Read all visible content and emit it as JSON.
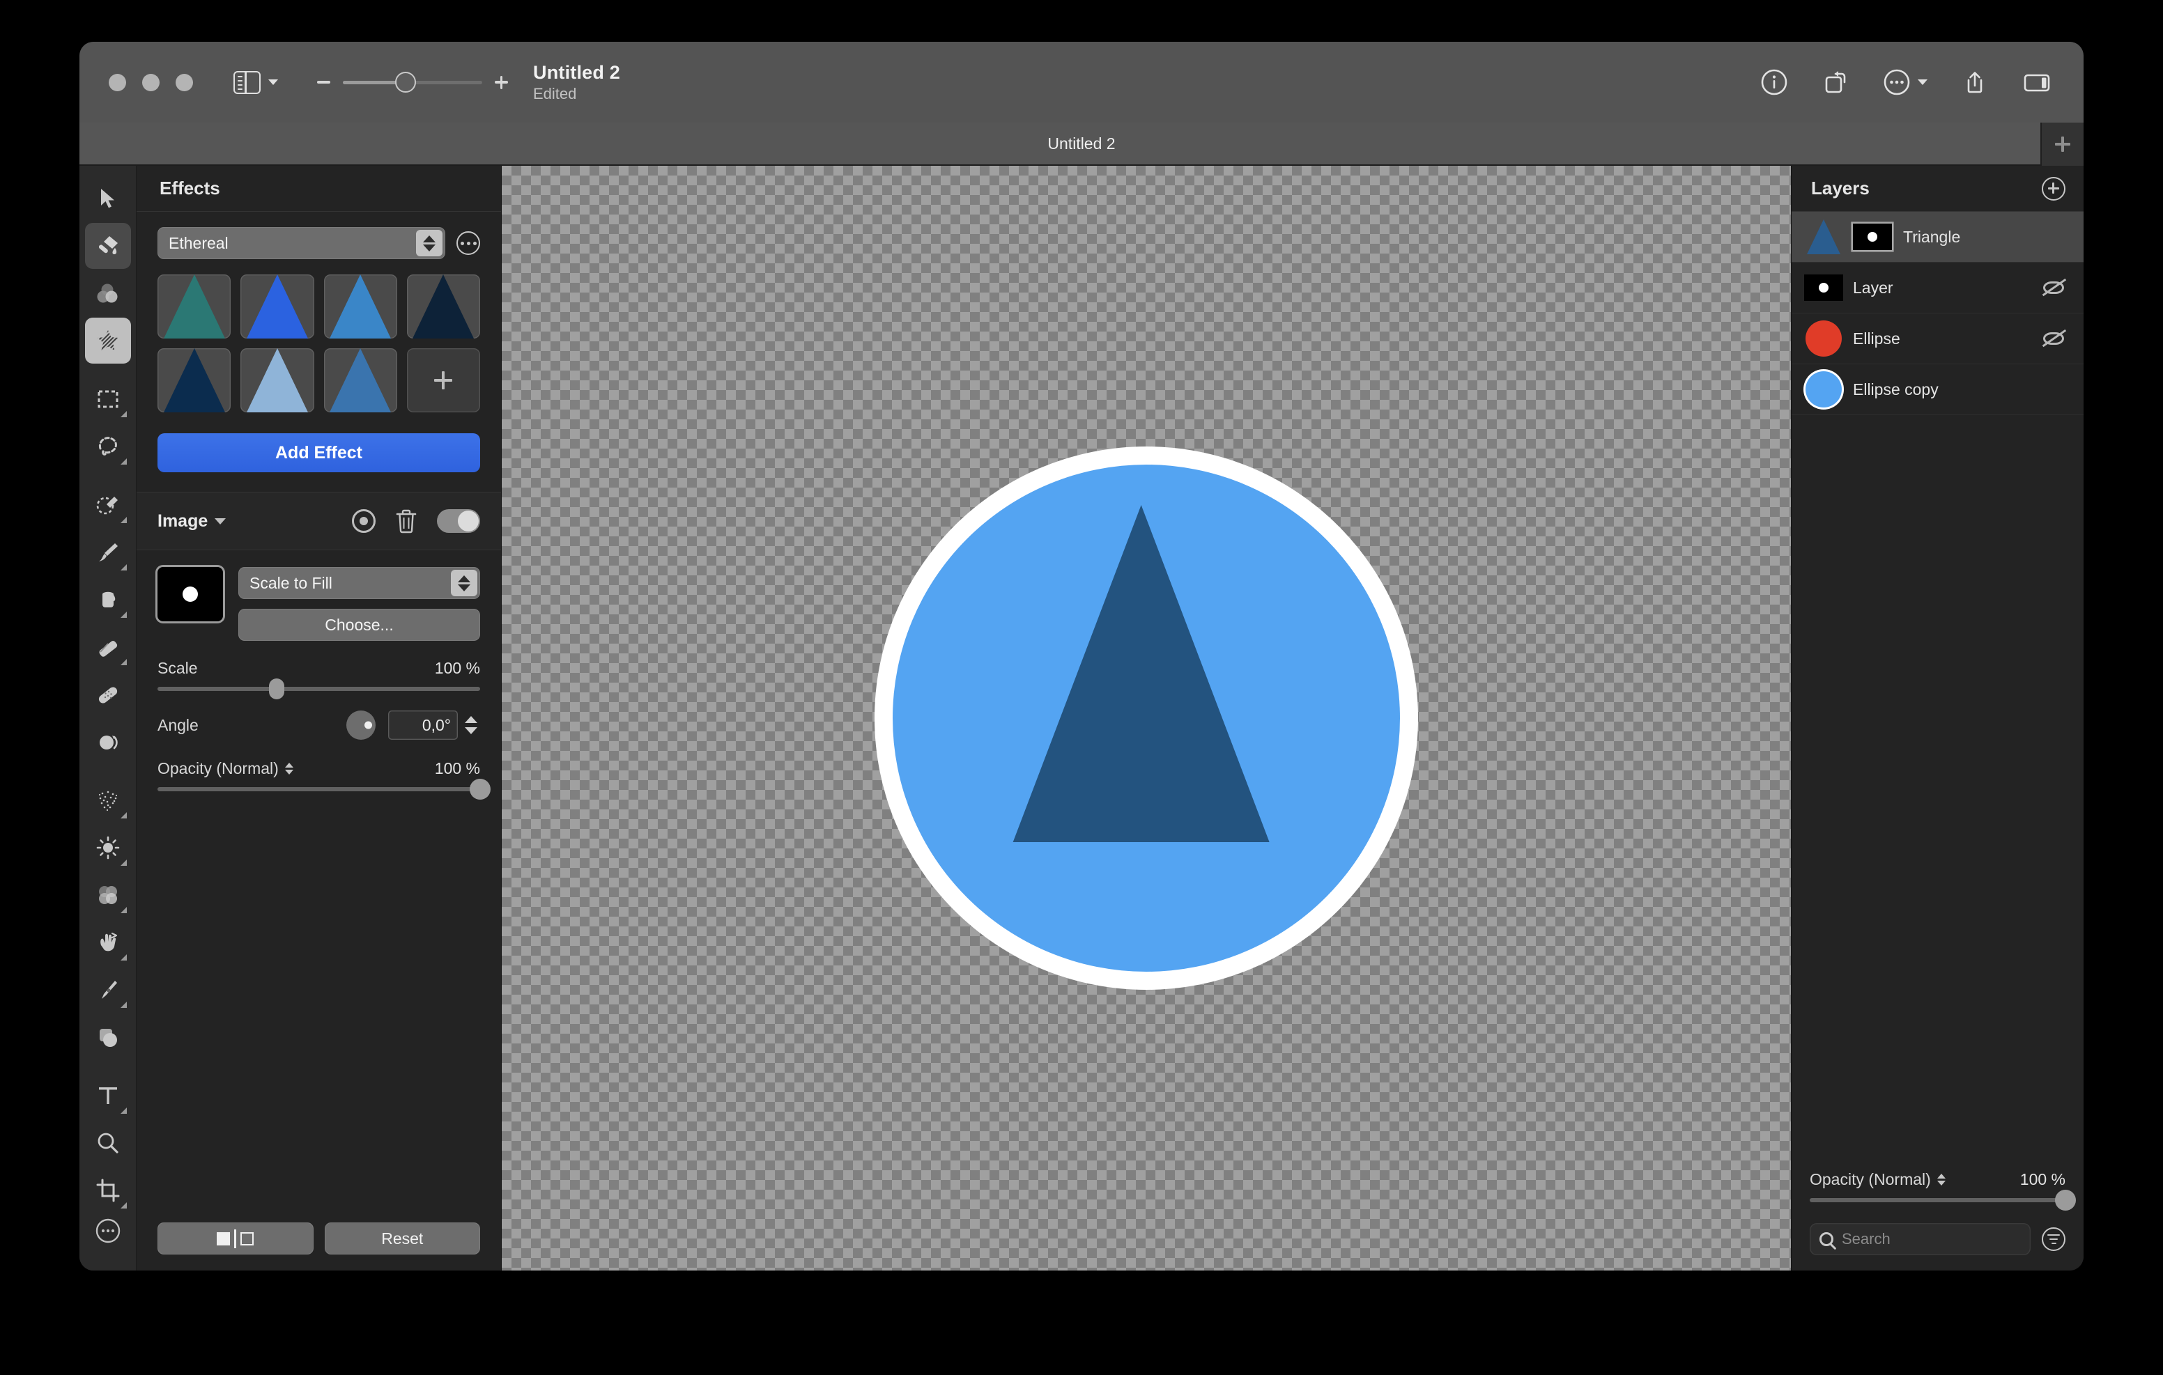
{
  "window": {
    "title": "Untitled 2",
    "subtitle": "Edited",
    "tab_label": "Untitled 2"
  },
  "titlebar": {
    "traffic_lights": [
      "close",
      "minimize",
      "zoom"
    ],
    "sidebar_toggle": "sidebar-toggle",
    "zoom_out": "−",
    "zoom_in": "+",
    "right_icons": [
      "info-icon",
      "rotate-icon",
      "more-icon",
      "share-icon",
      "inspector-toggle-icon"
    ]
  },
  "tools": {
    "items": [
      {
        "name": "arrange-tool",
        "icon": "arrow-cursor-icon",
        "state": "normal",
        "submenu": false
      },
      {
        "name": "paint-tool",
        "icon": "paint-brush-icon",
        "state": "dark",
        "submenu": false
      },
      {
        "name": "color-adjustments-tool",
        "icon": "color-circles-icon",
        "state": "normal",
        "submenu": false
      },
      {
        "name": "effects-tool",
        "icon": "effects-sparkle-icon",
        "state": "active",
        "submenu": false
      },
      {
        "name": "rectangular-select-tool",
        "icon": "marquee-rect-icon",
        "state": "normal",
        "submenu": true
      },
      {
        "name": "freeform-select-tool",
        "icon": "lasso-icon",
        "state": "normal",
        "submenu": true
      },
      {
        "name": "quick-select-tool",
        "icon": "magic-wand-icon",
        "state": "normal",
        "submenu": true
      },
      {
        "name": "paintbrush-tool",
        "icon": "paintbrush-icon",
        "state": "normal",
        "submenu": true
      },
      {
        "name": "paint-bucket-tool",
        "icon": "paint-bucket-icon",
        "state": "normal",
        "submenu": true
      },
      {
        "name": "eraser-tool",
        "icon": "eraser-icon",
        "state": "normal",
        "submenu": true
      },
      {
        "name": "repair-tool",
        "icon": "bandage-icon",
        "state": "normal",
        "submenu": false
      },
      {
        "name": "clone-tool",
        "icon": "clone-stamp-icon",
        "state": "normal",
        "submenu": false
      },
      {
        "name": "dither-tool",
        "icon": "noise-dots-icon",
        "state": "normal",
        "submenu": true
      },
      {
        "name": "lighten-tool",
        "icon": "sun-icon",
        "state": "normal",
        "submenu": true
      },
      {
        "name": "blur-tool",
        "icon": "blur-circles-icon",
        "state": "normal",
        "submenu": true
      },
      {
        "name": "warp-tool",
        "icon": "hand-warp-icon",
        "state": "normal",
        "submenu": true
      },
      {
        "name": "pen-tool",
        "icon": "pen-nib-icon",
        "state": "normal",
        "submenu": true
      },
      {
        "name": "shapes-tool",
        "icon": "shapes-icon",
        "state": "normal",
        "submenu": false
      },
      {
        "name": "type-tool",
        "icon": "text-t-icon",
        "state": "normal",
        "submenu": true
      },
      {
        "name": "zoom-tool",
        "icon": "magnifier-icon",
        "state": "normal",
        "submenu": false
      },
      {
        "name": "crop-tool",
        "icon": "crop-icon",
        "state": "normal",
        "submenu": true
      }
    ],
    "overflow": {
      "name": "more-tools-button",
      "icon": "ellipsis-circle-icon"
    }
  },
  "effects": {
    "header": "Effects",
    "preset": {
      "value": "Ethereal",
      "more_icon": "ellipsis-circle-icon"
    },
    "presets_grid": [
      {
        "name": "preset-1",
        "color": "#2b7874",
        "style": "flat"
      },
      {
        "name": "preset-2",
        "color": "#2b62e0",
        "style": "flat"
      },
      {
        "name": "preset-3",
        "color": "#3a86c8",
        "style": "gradient"
      },
      {
        "name": "preset-4",
        "color": "#0d2238",
        "style": "flat"
      },
      {
        "name": "preset-5",
        "color": "#0b2c4e",
        "style": "texture"
      },
      {
        "name": "preset-6",
        "color": "#8fb4d8",
        "style": "gradient"
      },
      {
        "name": "preset-7",
        "color": "#3a74ae",
        "style": "gradient"
      },
      {
        "name": "preset-add",
        "color": "",
        "style": "add"
      }
    ],
    "add_effect_label": "Add Effect",
    "layer_section": {
      "title": "Image",
      "target_icon": "target-icon",
      "delete_icon": "trash-icon",
      "enabled": true
    },
    "controls": {
      "image_well": "image-thumbnail",
      "fit_mode": "Scale to Fill",
      "choose_label": "Choose...",
      "scale_label": "Scale",
      "scale_value": "100 %",
      "scale_percent": 37,
      "angle_label": "Angle",
      "angle_value": "0,0°",
      "opacity_label": "Opacity (Normal)",
      "opacity_value": "100 %",
      "opacity_percent": 100
    },
    "footer": {
      "compare_label": "",
      "reset_label": "Reset"
    }
  },
  "layers": {
    "header": "Layers",
    "add_icon": "plus-circle-icon",
    "rows": [
      {
        "name": "Triangle",
        "thumb": "triangle-thumbnail",
        "mask": true,
        "selected": true,
        "hidden": false
      },
      {
        "name": "Layer",
        "thumb": "mask-thumbnail",
        "mask": false,
        "selected": false,
        "hidden": true
      },
      {
        "name": "Ellipse",
        "thumb": "red-circle-thumbnail",
        "mask": false,
        "selected": false,
        "hidden": true
      },
      {
        "name": "Ellipse copy",
        "thumb": "blue-circle-thumbnail",
        "mask": false,
        "selected": false,
        "hidden": false
      }
    ],
    "footer": {
      "opacity_label": "Opacity (Normal)",
      "opacity_value": "100 %",
      "opacity_percent": 100,
      "search_placeholder": "Search",
      "filter_icon": "filter-icon"
    }
  },
  "canvas": {
    "ring_color": "#ffffff",
    "disc_color": "#54a4f2",
    "triangle_color": "#23537f"
  }
}
